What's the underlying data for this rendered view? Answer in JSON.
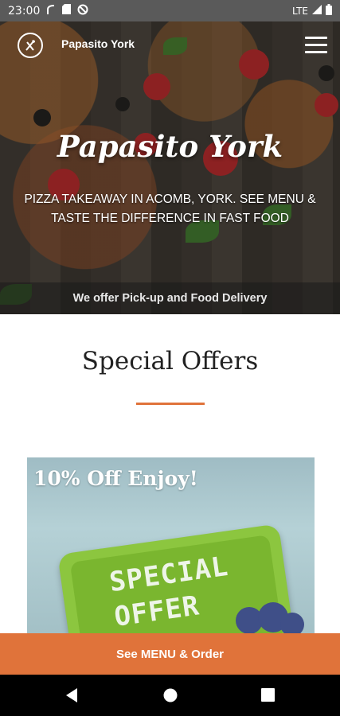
{
  "status_bar": {
    "time": "23:00",
    "network": "LTE"
  },
  "header": {
    "site_name": "Papasito York"
  },
  "hero": {
    "title": "Papasito York",
    "subtitle_line1": "PIZZA TAKEAWAY IN ACOMB, YORK. SEE MENU &",
    "subtitle_line2": "TASTE THE DIFFERENCE IN FAST FOOD",
    "strip_text": "We offer Pick-up and Food Delivery"
  },
  "section": {
    "title": "Special Offers"
  },
  "offer": {
    "heading": "10% Off Enjoy!",
    "sign_line1": "SPECIAL",
    "sign_line2": "OFFER"
  },
  "bottom_cta": {
    "label": "See MENU & Order"
  },
  "colors": {
    "accent": "#e0733a",
    "status_bar": "#5a5a5a",
    "nav_bar": "#000000"
  },
  "icons": {
    "status_left": [
      "mobile-data-icon",
      "sd-card-icon",
      "do-not-disturb-icon"
    ],
    "status_right": [
      "signal-icon",
      "battery-icon"
    ],
    "logo": "fork-knife-logo-icon",
    "menu": "hamburger-menu-icon",
    "nav": [
      "back-icon",
      "home-icon",
      "recents-icon"
    ]
  }
}
